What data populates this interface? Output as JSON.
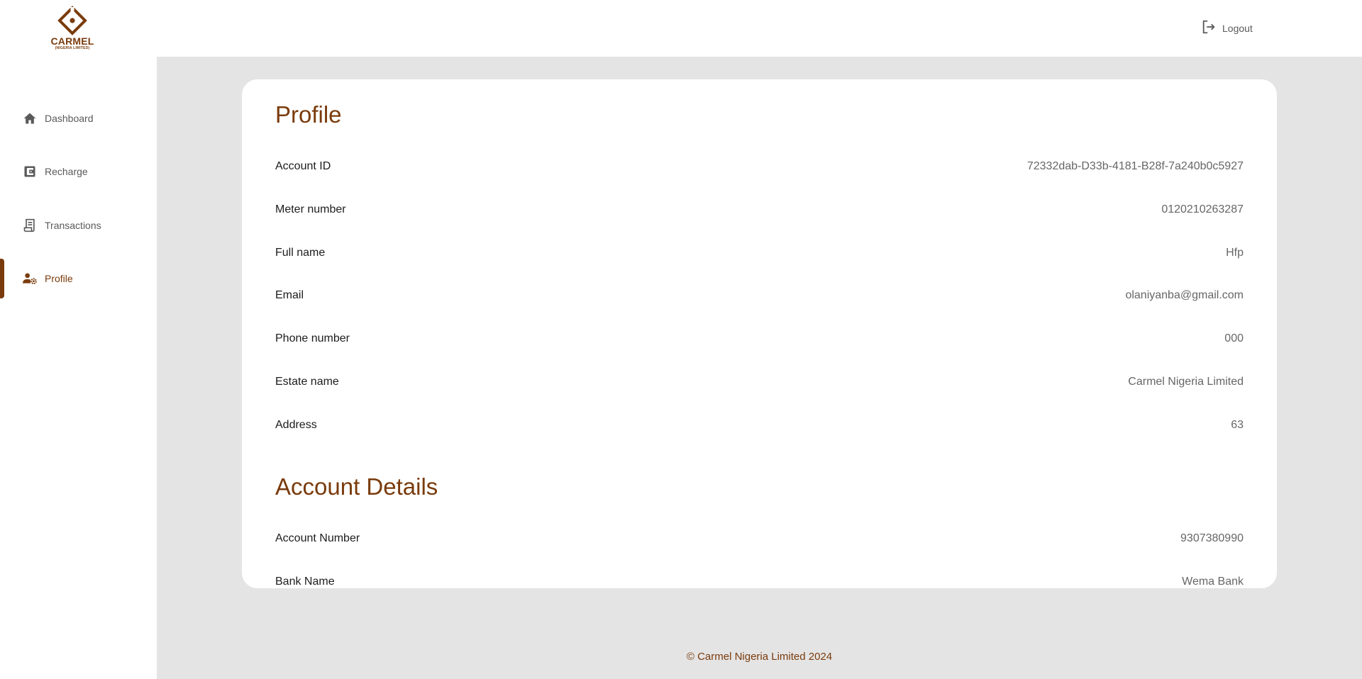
{
  "brand": {
    "name": "CARMEL",
    "subtitle": "(NIGERIA LIMITED)",
    "color": "#7a3b0c"
  },
  "sidebar": {
    "items": [
      {
        "label": "Dashboard",
        "icon": "home-icon",
        "active": false
      },
      {
        "label": "Recharge",
        "icon": "wallet-icon",
        "active": false
      },
      {
        "label": "Transactions",
        "icon": "receipt-icon",
        "active": false
      },
      {
        "label": "Profile",
        "icon": "user-settings-icon",
        "active": true
      }
    ]
  },
  "header": {
    "logout_label": "Logout",
    "logout_icon": "logout-icon"
  },
  "profile": {
    "title": "Profile",
    "rows": [
      {
        "label": "Account ID",
        "value": "72332dab-D33b-4181-B28f-7a240b0c5927"
      },
      {
        "label": "Meter number",
        "value": "0120210263287"
      },
      {
        "label": "Full name",
        "value": "Hfp"
      },
      {
        "label": "Email",
        "value": "olaniyanba@gmail.com"
      },
      {
        "label": "Phone number",
        "value": "000"
      },
      {
        "label": "Estate name",
        "value": "Carmel Nigeria Limited"
      },
      {
        "label": "Address",
        "value": "63"
      }
    ]
  },
  "account_details": {
    "title": "Account Details",
    "rows": [
      {
        "label": "Account Number",
        "value": "9307380990"
      },
      {
        "label": "Bank Name",
        "value": "Wema Bank"
      }
    ]
  },
  "footer": {
    "text": "© Carmel Nigeria Limited 2024"
  }
}
